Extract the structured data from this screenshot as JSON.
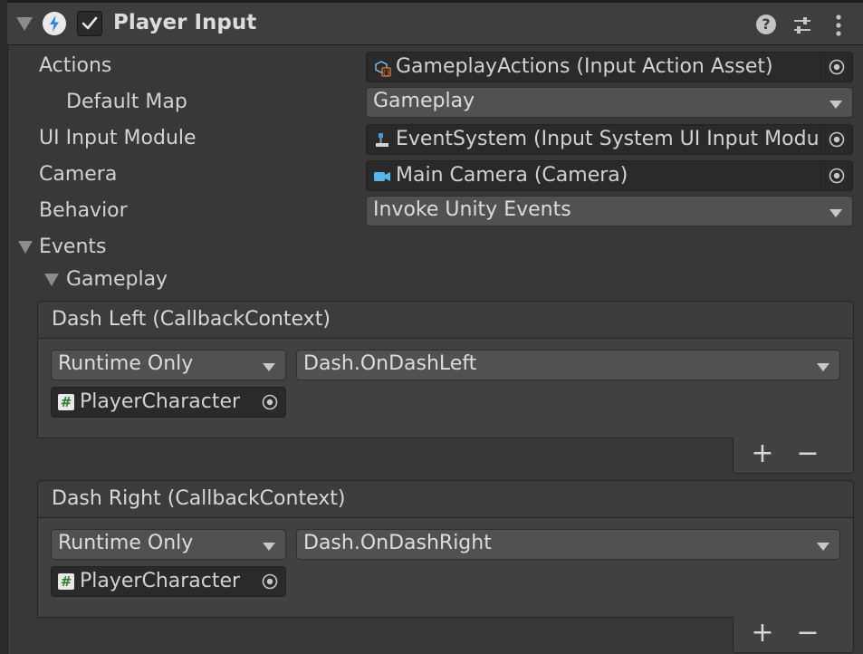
{
  "component": {
    "title": "Player Input",
    "enabled": true
  },
  "properties": {
    "actions": {
      "label": "Actions",
      "value": "GameplayActions (Input Action Asset)"
    },
    "default_map": {
      "label": "Default Map",
      "value": "Gameplay"
    },
    "ui_input_module": {
      "label": "UI Input Module",
      "value": "EventSystem (Input System UI Input Modu"
    },
    "camera": {
      "label": "Camera",
      "value": "Main Camera (Camera)"
    },
    "behavior": {
      "label": "Behavior",
      "value": "Invoke Unity Events"
    }
  },
  "events": {
    "label": "Events",
    "map_label": "Gameplay",
    "items": [
      {
        "title": "Dash Left (CallbackContext)",
        "call_state": "Runtime Only",
        "function": "Dash.OnDashLeft",
        "target": "PlayerCharacter"
      },
      {
        "title": "Dash Right (CallbackContext)",
        "call_state": "Runtime Only",
        "function": "Dash.OnDashRight",
        "target": "PlayerCharacter"
      }
    ],
    "add_label": "+",
    "remove_label": "−"
  },
  "icons": {
    "component": "input-lightning-icon",
    "actions_asset": "input-action-asset-icon",
    "event_system": "event-system-icon",
    "camera": "camera-icon",
    "script": "script-hash-icon",
    "object_picker": "object-picker-icon"
  },
  "colors": {
    "background": "#383838",
    "field": "#2a2a2a",
    "dropdown": "#515151",
    "text": "#d2d2d2",
    "accent_blue": "#3a9be0"
  }
}
